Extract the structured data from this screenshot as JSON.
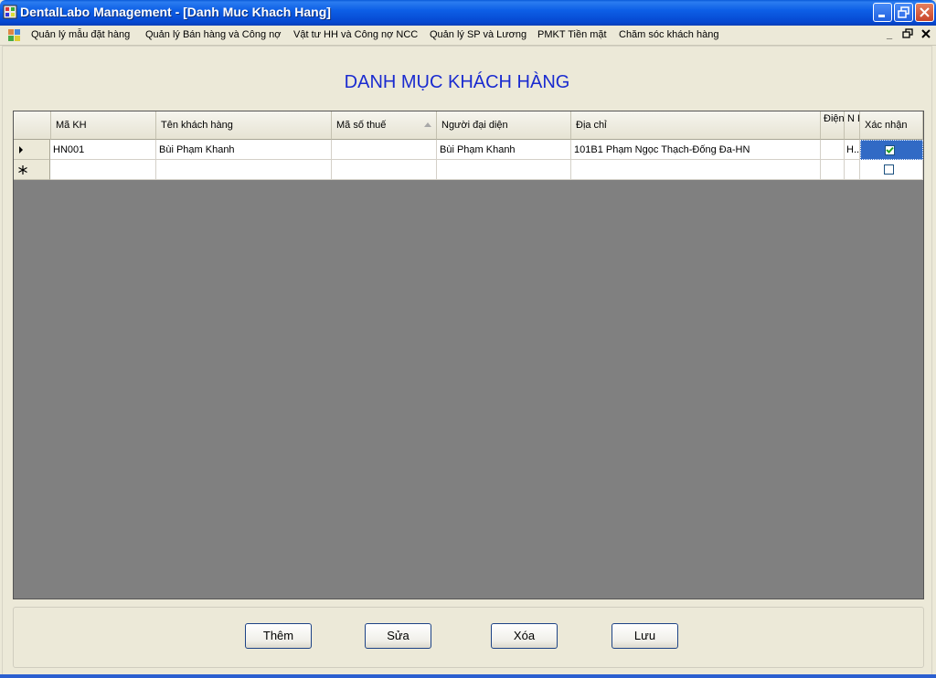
{
  "window": {
    "title": "DentalLabo Management - [Danh Muc Khach Hang]"
  },
  "menu": {
    "items": [
      "Quản lý mẫu đặt hàng",
      "Quản lý Bán hàng và Công nợ",
      "Vật tư HH và Công nợ NCC",
      "Quản lý SP và Lương",
      "PMKT Tiền mặt",
      "Chăm sóc khách hàng"
    ]
  },
  "page": {
    "title": "DANH MỤC KHÁCH HÀNG"
  },
  "grid": {
    "columns": [
      "Mã KH",
      "Tên khách hàng",
      "Mã số thuế",
      "Người đại diện",
      "Địa chỉ",
      "Điện thoại",
      "N K",
      "Xác nhận"
    ],
    "sorted_column": "Mã số thuế",
    "rows": [
      {
        "ma_kh": "HN001",
        "ten_kh": "Bùi Phạm Khanh",
        "ma_so_thue": "",
        "nguoi_dai_dien": "Bùi Phạm Khanh",
        "dia_chi": "101B1 Phạm Ngọc Thạch-Đống Đa-HN",
        "dien_thoai": "",
        "nk": "H..",
        "xac_nhan": true
      }
    ],
    "new_row": {
      "xac_nhan": false
    }
  },
  "buttons": {
    "them": "Thêm",
    "sua": "Sửa",
    "xoa": "Xóa",
    "luu": "Lưu"
  },
  "colors": {
    "title_blue": "#1a2bd0",
    "titlebar": "#0d5fe6",
    "grid_empty": "#808080"
  }
}
